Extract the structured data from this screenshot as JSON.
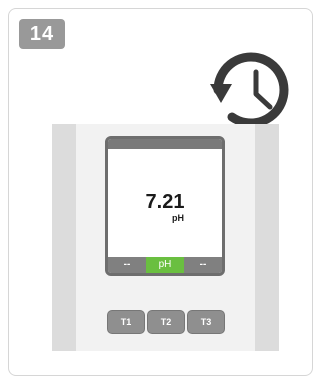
{
  "step": {
    "number": "14"
  },
  "icons": {
    "history": "history-icon"
  },
  "display": {
    "value": "7.21",
    "unit": "pH",
    "softkeys": [
      "--",
      "pH",
      "--"
    ],
    "active_softkey_color": "#6abf40"
  },
  "buttons": [
    "T1",
    "T2",
    "T3"
  ]
}
